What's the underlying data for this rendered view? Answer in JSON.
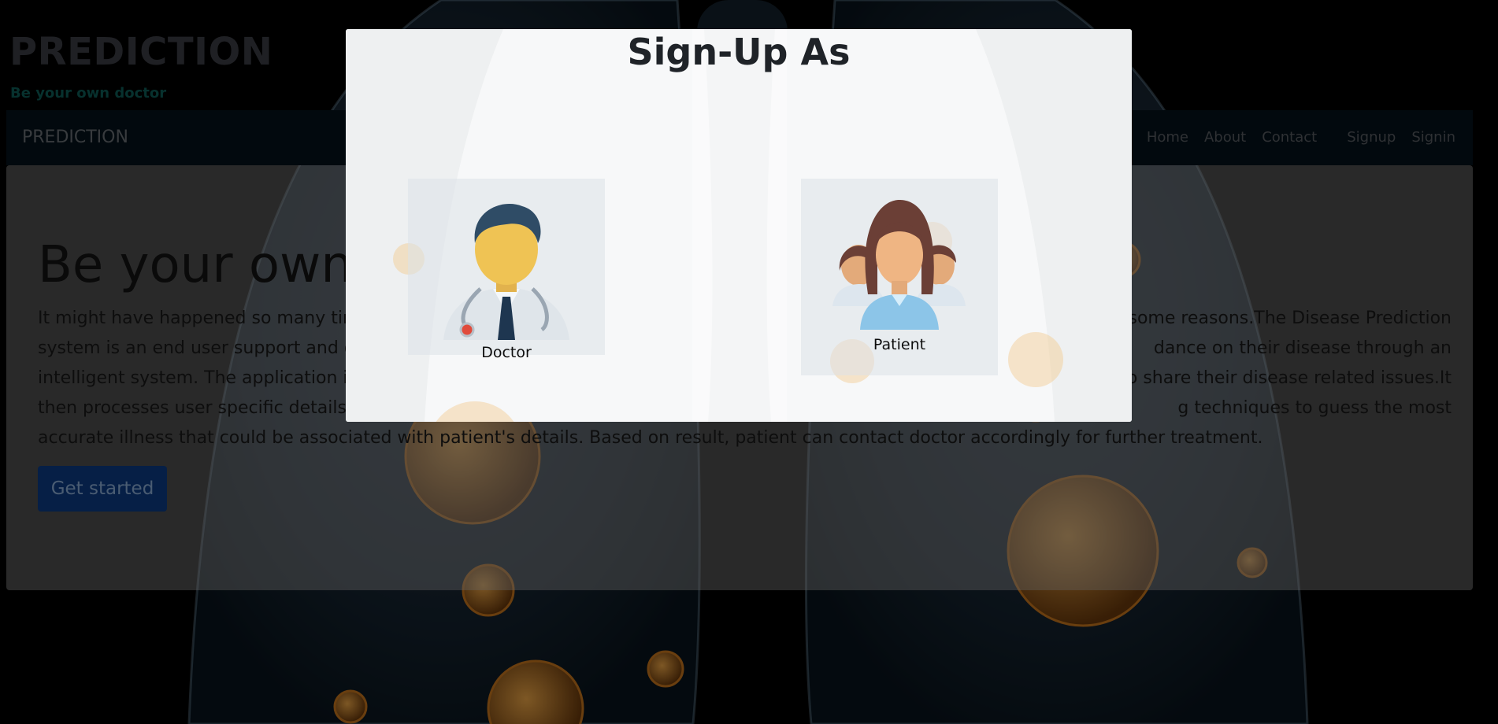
{
  "header": {
    "brand": "PREDICTION",
    "tagline": "Be your own doctor"
  },
  "navbar": {
    "brand": "PREDICTION",
    "links": [
      "Home",
      "About",
      "Contact",
      "Signup",
      "Signin"
    ]
  },
  "hero": {
    "title": "Be your own d",
    "paragraph_visible_lines": [
      "It might have happened so many time",
      "some reasons.The Disease Prediction",
      "system is an end user support and on",
      "dance on their disease through an",
      "intelligent system. The application is fe",
      "o share their disease related issues.It",
      "then processes user specific details to",
      "g techniques to guess the most",
      "accurate illness that could be associated with patient's details. Based on result, patient can contact doctor accordingly for further treatment."
    ],
    "cta_label": "Get started"
  },
  "modal": {
    "title": "Sign-Up As",
    "options": [
      {
        "label": "Doctor",
        "icon": "doctor-avatar-icon"
      },
      {
        "label": "Patient",
        "icon": "patients-group-icon"
      }
    ]
  },
  "colors": {
    "background": "#000000",
    "navbar": "#05131c",
    "cta": "#0c3c86",
    "tagline": "#0f5e58",
    "virus": "#c9771e"
  }
}
